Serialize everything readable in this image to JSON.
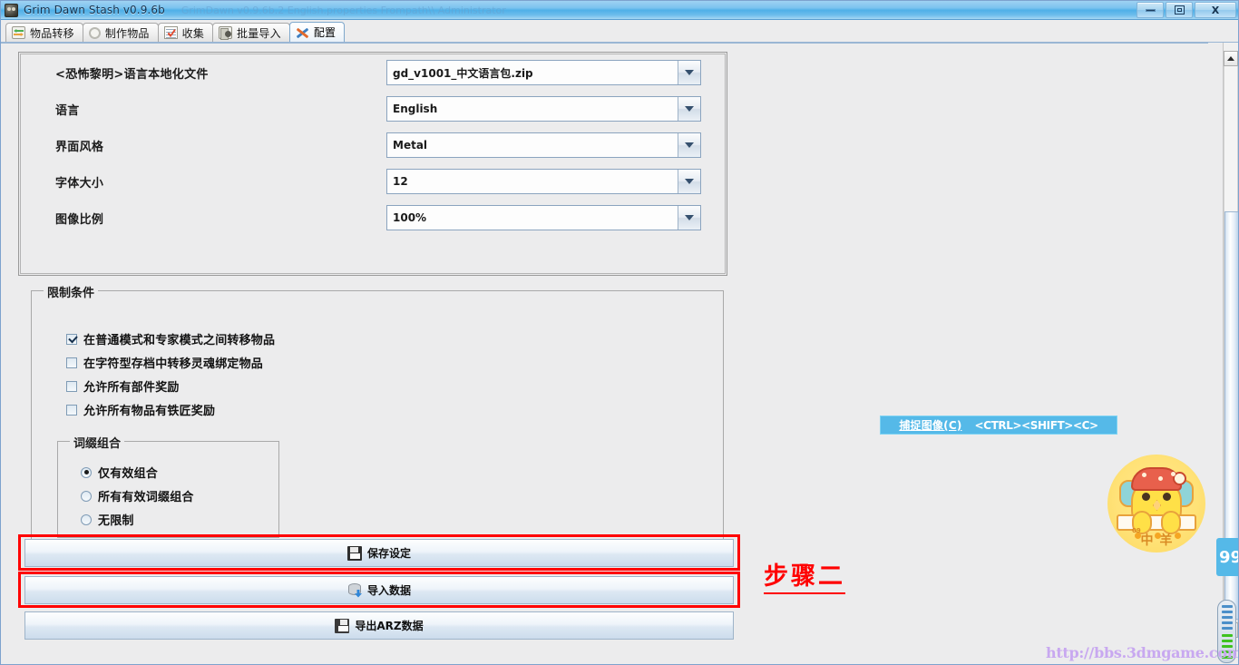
{
  "window": {
    "title": "Grim Dawn Stash v0.9.6b",
    "subtitle": "GrimDawn v0.9.6b.2 English.properties  Frompath\\\\ Administrator",
    "controls": {
      "minimize": "minimize-button",
      "maximize": "maximize-button",
      "close": "X"
    }
  },
  "tabs": [
    {
      "label": "物品转移",
      "icon": "transfer-icon",
      "active": false
    },
    {
      "label": "制作物品",
      "icon": "gear-icon",
      "active": false
    },
    {
      "label": "收集",
      "icon": "checklist-icon",
      "active": false
    },
    {
      "label": "批量导入",
      "icon": "batch-import-icon",
      "active": false
    },
    {
      "label": "配置",
      "icon": "tools-icon",
      "active": true
    }
  ],
  "settings": {
    "rows": [
      {
        "label": "<恐怖黎明>语言本地化文件",
        "value": "gd_v1001_中文语言包.zip"
      },
      {
        "label": "语言",
        "value": "English"
      },
      {
        "label": "界面风格",
        "value": "Metal"
      },
      {
        "label": "字体大小",
        "value": "12"
      },
      {
        "label": "图像比例",
        "value": "100%"
      }
    ]
  },
  "restrictions": {
    "title": "限制条件",
    "checkboxes": [
      {
        "label": "在普通模式和专家模式之间转移物品",
        "checked": true
      },
      {
        "label": "在字符型存档中转移灵魂绑定物品",
        "checked": false
      },
      {
        "label": "允许所有部件奖励",
        "checked": false
      },
      {
        "label": "允许所有物品有铁匠奖励",
        "checked": false
      }
    ],
    "affix": {
      "title": "词缀组合",
      "options": [
        {
          "label": "仅有效组合",
          "selected": true
        },
        {
          "label": "所有有效词缀组合",
          "selected": false
        },
        {
          "label": "无限制",
          "selected": false
        }
      ]
    }
  },
  "actions": [
    {
      "label": "保存设定",
      "icon": "floppy-save-icon",
      "highlighted": true
    },
    {
      "label": "导入数据",
      "icon": "database-import-icon",
      "highlighted": true
    },
    {
      "label": "导出ARZ数据",
      "icon": "floppy-export-icon",
      "highlighted": false
    }
  ],
  "annotation": {
    "step_text": "步骤二",
    "color": "#ff0000"
  },
  "capture_tip": {
    "label": "捕捉图像(C)",
    "shortcut": "<CTRL><SHIFT><C>",
    "background": "#55b9e8"
  },
  "mascot": {
    "text": "中羊",
    "sub": "09",
    "background": "#ffe278"
  },
  "watermark": {
    "text": "http://bbs.3dmgame.com",
    "color": "#c8a8f0"
  },
  "overlays": {
    "count_badge": "99"
  }
}
